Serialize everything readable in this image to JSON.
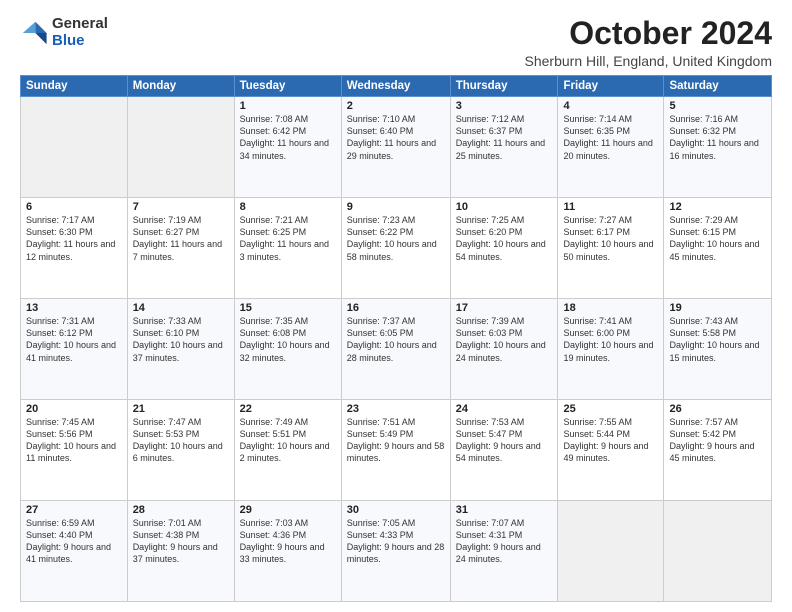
{
  "logo": {
    "general": "General",
    "blue": "Blue"
  },
  "title": "October 2024",
  "location": "Sherburn Hill, England, United Kingdom",
  "days_of_week": [
    "Sunday",
    "Monday",
    "Tuesday",
    "Wednesday",
    "Thursday",
    "Friday",
    "Saturday"
  ],
  "weeks": [
    [
      {
        "day": "",
        "detail": ""
      },
      {
        "day": "",
        "detail": ""
      },
      {
        "day": "1",
        "detail": "Sunrise: 7:08 AM\nSunset: 6:42 PM\nDaylight: 11 hours and 34 minutes."
      },
      {
        "day": "2",
        "detail": "Sunrise: 7:10 AM\nSunset: 6:40 PM\nDaylight: 11 hours and 29 minutes."
      },
      {
        "day": "3",
        "detail": "Sunrise: 7:12 AM\nSunset: 6:37 PM\nDaylight: 11 hours and 25 minutes."
      },
      {
        "day": "4",
        "detail": "Sunrise: 7:14 AM\nSunset: 6:35 PM\nDaylight: 11 hours and 20 minutes."
      },
      {
        "day": "5",
        "detail": "Sunrise: 7:16 AM\nSunset: 6:32 PM\nDaylight: 11 hours and 16 minutes."
      }
    ],
    [
      {
        "day": "6",
        "detail": "Sunrise: 7:17 AM\nSunset: 6:30 PM\nDaylight: 11 hours and 12 minutes."
      },
      {
        "day": "7",
        "detail": "Sunrise: 7:19 AM\nSunset: 6:27 PM\nDaylight: 11 hours and 7 minutes."
      },
      {
        "day": "8",
        "detail": "Sunrise: 7:21 AM\nSunset: 6:25 PM\nDaylight: 11 hours and 3 minutes."
      },
      {
        "day": "9",
        "detail": "Sunrise: 7:23 AM\nSunset: 6:22 PM\nDaylight: 10 hours and 58 minutes."
      },
      {
        "day": "10",
        "detail": "Sunrise: 7:25 AM\nSunset: 6:20 PM\nDaylight: 10 hours and 54 minutes."
      },
      {
        "day": "11",
        "detail": "Sunrise: 7:27 AM\nSunset: 6:17 PM\nDaylight: 10 hours and 50 minutes."
      },
      {
        "day": "12",
        "detail": "Sunrise: 7:29 AM\nSunset: 6:15 PM\nDaylight: 10 hours and 45 minutes."
      }
    ],
    [
      {
        "day": "13",
        "detail": "Sunrise: 7:31 AM\nSunset: 6:12 PM\nDaylight: 10 hours and 41 minutes."
      },
      {
        "day": "14",
        "detail": "Sunrise: 7:33 AM\nSunset: 6:10 PM\nDaylight: 10 hours and 37 minutes."
      },
      {
        "day": "15",
        "detail": "Sunrise: 7:35 AM\nSunset: 6:08 PM\nDaylight: 10 hours and 32 minutes."
      },
      {
        "day": "16",
        "detail": "Sunrise: 7:37 AM\nSunset: 6:05 PM\nDaylight: 10 hours and 28 minutes."
      },
      {
        "day": "17",
        "detail": "Sunrise: 7:39 AM\nSunset: 6:03 PM\nDaylight: 10 hours and 24 minutes."
      },
      {
        "day": "18",
        "detail": "Sunrise: 7:41 AM\nSunset: 6:00 PM\nDaylight: 10 hours and 19 minutes."
      },
      {
        "day": "19",
        "detail": "Sunrise: 7:43 AM\nSunset: 5:58 PM\nDaylight: 10 hours and 15 minutes."
      }
    ],
    [
      {
        "day": "20",
        "detail": "Sunrise: 7:45 AM\nSunset: 5:56 PM\nDaylight: 10 hours and 11 minutes."
      },
      {
        "day": "21",
        "detail": "Sunrise: 7:47 AM\nSunset: 5:53 PM\nDaylight: 10 hours and 6 minutes."
      },
      {
        "day": "22",
        "detail": "Sunrise: 7:49 AM\nSunset: 5:51 PM\nDaylight: 10 hours and 2 minutes."
      },
      {
        "day": "23",
        "detail": "Sunrise: 7:51 AM\nSunset: 5:49 PM\nDaylight: 9 hours and 58 minutes."
      },
      {
        "day": "24",
        "detail": "Sunrise: 7:53 AM\nSunset: 5:47 PM\nDaylight: 9 hours and 54 minutes."
      },
      {
        "day": "25",
        "detail": "Sunrise: 7:55 AM\nSunset: 5:44 PM\nDaylight: 9 hours and 49 minutes."
      },
      {
        "day": "26",
        "detail": "Sunrise: 7:57 AM\nSunset: 5:42 PM\nDaylight: 9 hours and 45 minutes."
      }
    ],
    [
      {
        "day": "27",
        "detail": "Sunrise: 6:59 AM\nSunset: 4:40 PM\nDaylight: 9 hours and 41 minutes."
      },
      {
        "day": "28",
        "detail": "Sunrise: 7:01 AM\nSunset: 4:38 PM\nDaylight: 9 hours and 37 minutes."
      },
      {
        "day": "29",
        "detail": "Sunrise: 7:03 AM\nSunset: 4:36 PM\nDaylight: 9 hours and 33 minutes."
      },
      {
        "day": "30",
        "detail": "Sunrise: 7:05 AM\nSunset: 4:33 PM\nDaylight: 9 hours and 28 minutes."
      },
      {
        "day": "31",
        "detail": "Sunrise: 7:07 AM\nSunset: 4:31 PM\nDaylight: 9 hours and 24 minutes."
      },
      {
        "day": "",
        "detail": ""
      },
      {
        "day": "",
        "detail": ""
      }
    ]
  ]
}
